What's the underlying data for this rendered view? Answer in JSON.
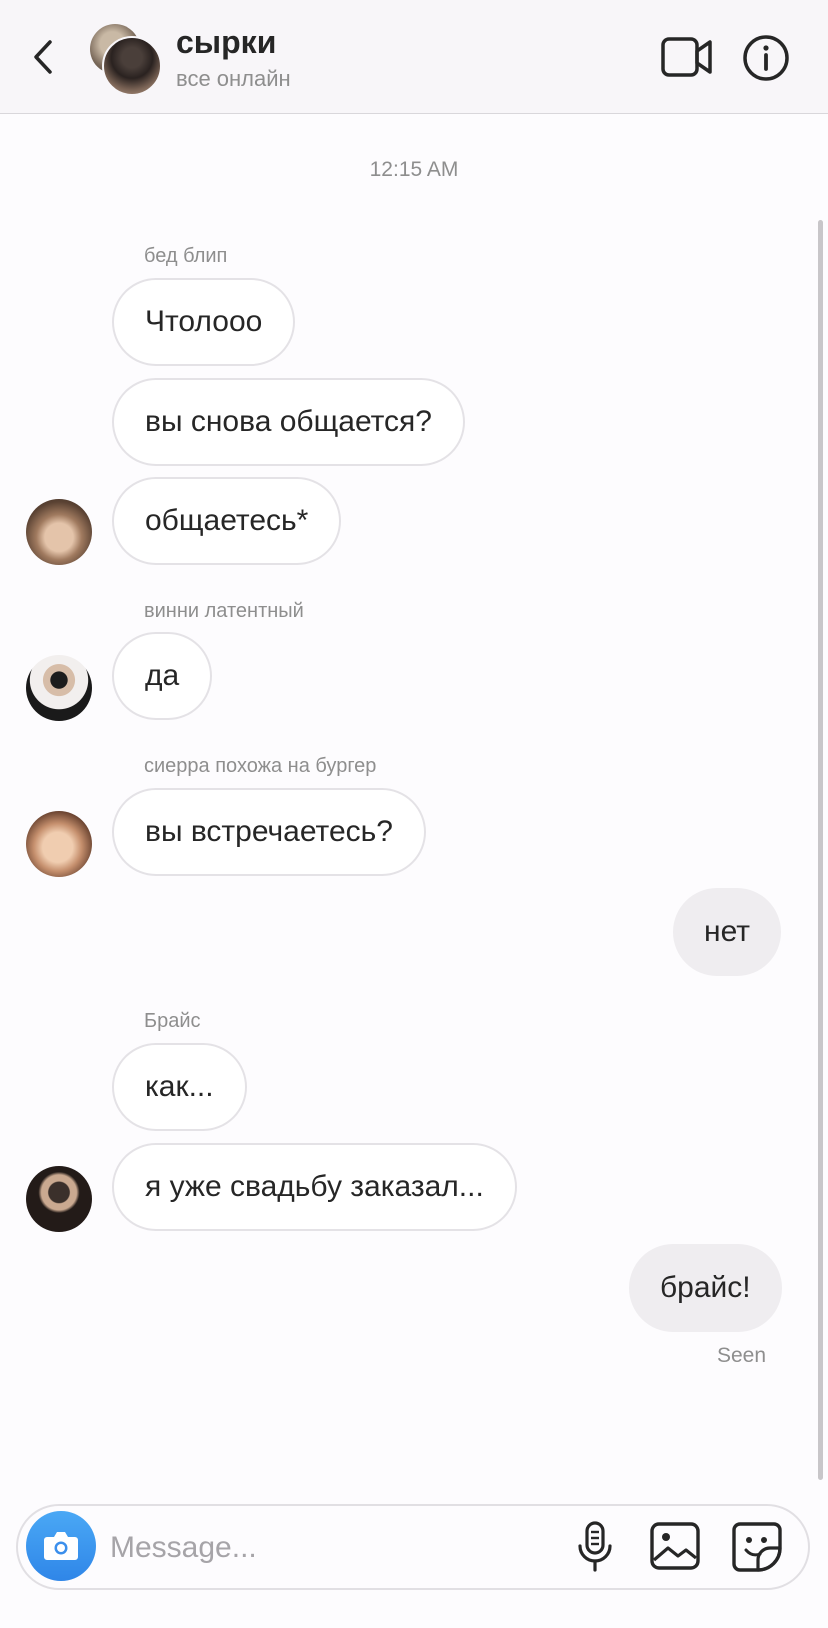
{
  "header": {
    "title": "сырки",
    "subtitle": "все онлайн",
    "icons": {
      "back": "chevron-left-icon",
      "video": "video-camera-icon",
      "info": "info-icon"
    }
  },
  "chat": {
    "timestamp": "12:15 AM",
    "senders": [
      "бед блип",
      "винни латентный",
      "сиерра похожа на бургер",
      "Брайс"
    ],
    "messages": [
      {
        "sender": "бед блип",
        "text": "Чтолооо",
        "direction": "incoming"
      },
      {
        "sender": "бед блип",
        "text": "вы снова общается?",
        "direction": "incoming"
      },
      {
        "sender": "бед блип",
        "text": "общаетесь*",
        "direction": "incoming"
      },
      {
        "sender": "винни латентный",
        "text": "да",
        "direction": "incoming"
      },
      {
        "sender": "сиерра похожа на бургер",
        "text": "вы встречаетесь?",
        "direction": "incoming"
      },
      {
        "sender": "me",
        "text": "нет",
        "direction": "outgoing"
      },
      {
        "sender": "Брайс",
        "text": "как...",
        "direction": "incoming"
      },
      {
        "sender": "Брайс",
        "text": "я уже свадьбу заказал...",
        "direction": "incoming"
      },
      {
        "sender": "me",
        "text": "брайс!",
        "direction": "outgoing"
      }
    ],
    "seen_label": "Seen"
  },
  "composer": {
    "placeholder": "Message...",
    "icons": {
      "camera": "camera-icon",
      "mic": "microphone-icon",
      "gallery": "image-icon",
      "sticker": "sticker-icon"
    }
  },
  "colors": {
    "accent_blue": "#3797f0",
    "incoming_bubble_border": "#e4e2e6",
    "outgoing_bubble": "#efedf0",
    "secondary_text": "#8e8e8e",
    "header_bg": "#f8f6f9"
  }
}
